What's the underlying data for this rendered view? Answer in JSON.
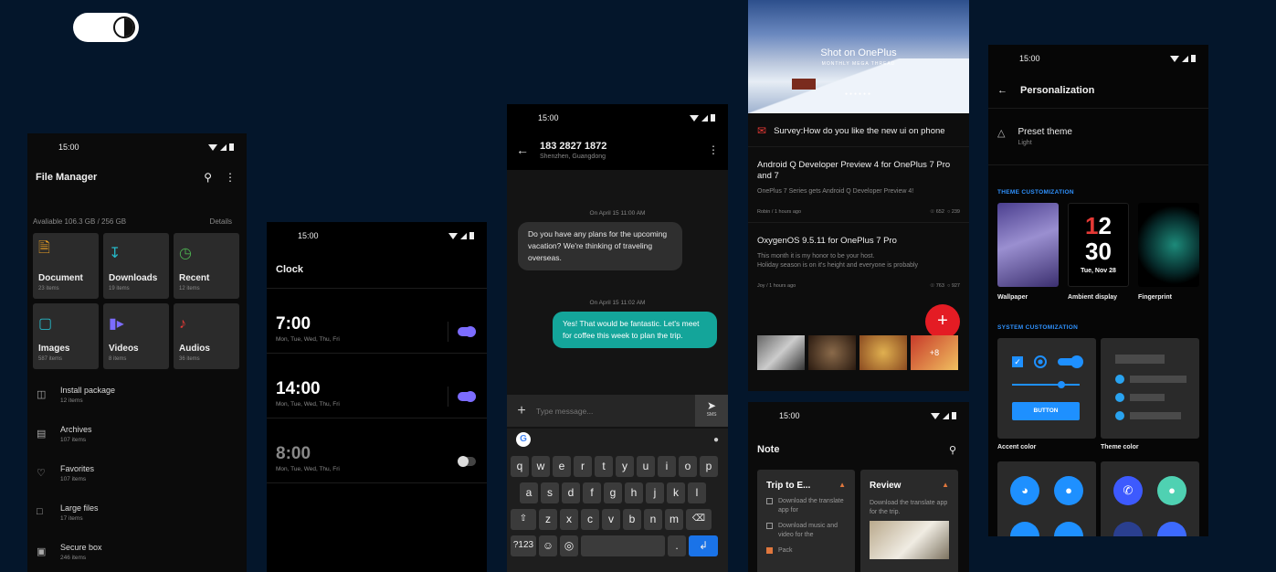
{
  "file_manager": {
    "time": "15:00",
    "title": "File Manager",
    "storage": "Avaliable 106.3 GB / 256 GB",
    "details": "Details",
    "tiles": [
      {
        "label": "Document",
        "sub": "23 items",
        "icon": "document-icon",
        "color": "#f5a623"
      },
      {
        "label": "Downloads",
        "sub": "19 items",
        "icon": "download-icon",
        "color": "#26b7c6"
      },
      {
        "label": "Recent",
        "sub": "12 items",
        "icon": "clock-icon",
        "color": "#4caf50"
      },
      {
        "label": "Images",
        "sub": "587 items",
        "icon": "image-icon",
        "color": "#26b7c6"
      },
      {
        "label": "Videos",
        "sub": "8 items",
        "icon": "video-icon",
        "color": "#7c6cff"
      },
      {
        "label": "Audios",
        "sub": "36 items",
        "icon": "music-icon",
        "color": "#e53935"
      }
    ],
    "list": [
      {
        "label": "Install package",
        "sub": "12 items"
      },
      {
        "label": "Archives",
        "sub": "107 items"
      },
      {
        "label": "Favorites",
        "sub": "107 items"
      },
      {
        "label": "Large files",
        "sub": "17 items"
      },
      {
        "label": "Secure box",
        "sub": "246 items"
      }
    ]
  },
  "clock": {
    "time": "15:00",
    "title": "Clock",
    "alarms": [
      {
        "time": "7:00",
        "days": "Mon, Tue, Wed, Thu, Fri",
        "enabled": true
      },
      {
        "time": "14:00",
        "days": "Mon, Tue, Wed, Thu, Fri",
        "enabled": true
      },
      {
        "time": "8:00",
        "days": "Mon, Tue, Wed, Thu, Fri",
        "enabled": false
      }
    ]
  },
  "messages": {
    "time": "15:00",
    "contact": "183 2827 1872",
    "location": "Shenzhen, Guangdong",
    "ts1": "On April 15 11:00 AM",
    "in_msg": "Do you have any plans for the upcoming vacation? We're thinking of traveling overseas.",
    "ts2": "On April 15 11:02 AM",
    "out_msg": "Yes! That would be fantastic. Let's meet for coffee this week to plan the trip.",
    "placeholder": "Type message...",
    "send_label": "SMS",
    "keyboard": {
      "row1": [
        "q",
        "w",
        "e",
        "r",
        "t",
        "y",
        "u",
        "i",
        "o",
        "p"
      ],
      "row2": [
        "a",
        "s",
        "d",
        "f",
        "g",
        "h",
        "j",
        "k",
        "l"
      ],
      "row3": [
        "z",
        "x",
        "c",
        "v",
        "b",
        "n",
        "m"
      ],
      "num_key": "?123"
    }
  },
  "forum": {
    "banner_title": "Shot on OnePlus",
    "banner_sub": "MONTHLY MEGA THREAD",
    "survey": "Survey:How do you like the new ui on phone",
    "posts": [
      {
        "title": "Android Q Developer Preview 4 for OnePlus 7 Pro and 7",
        "desc": "OnePlus 7 Series gets Android Q Developer Preview 4!",
        "author": "Robin / 1 hours ago",
        "views": "652",
        "comments": "239"
      },
      {
        "title": "OxygenOS 9.5.11 for OnePlus 7 Pro",
        "desc": "This month it is my honor to be your host.\nHoliday season is on it's height and everyone is probably",
        "author": "Joy / 1 hours ago",
        "views": "763",
        "comments": "927"
      }
    ],
    "more_count": "+8"
  },
  "notes": {
    "time": "15:00",
    "title": "Note",
    "cards": [
      {
        "title": "Trip to E...",
        "items": [
          {
            "text": "Download the translate app for",
            "done": false
          },
          {
            "text": "Download music and video for the",
            "done": false
          },
          {
            "text": "Pack",
            "done": true
          }
        ]
      },
      {
        "title": "Review",
        "desc": "Download the translate app for the trip."
      }
    ]
  },
  "personalization": {
    "time": "15:00",
    "title": "Personalization",
    "preset_title": "Preset theme",
    "preset_sub": "Light",
    "theme_section": "THEME CUSTOMIZATION",
    "themes": [
      "Wallpaper",
      "Ambient display",
      "Fingerprint"
    ],
    "clock_hour": "1",
    "clock_hour2": "2",
    "clock_min": "30",
    "clock_date": "Tue, Nov 28",
    "system_section": "SYSTEM CUSTOMIZATION",
    "accent_label": "Accent color",
    "theme_color_label": "Theme color",
    "button_label": "BUTTON"
  }
}
